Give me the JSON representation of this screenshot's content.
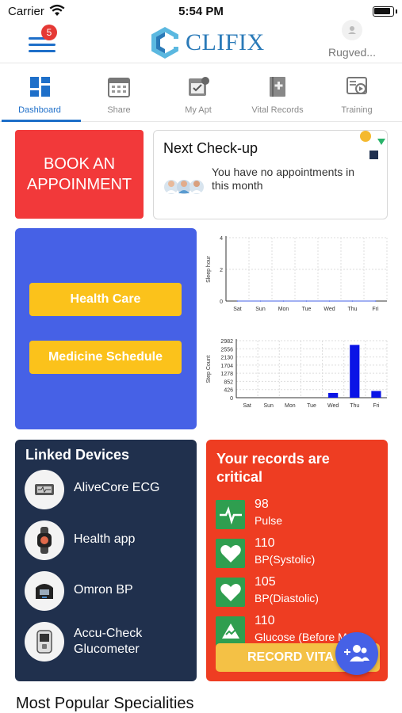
{
  "status_bar": {
    "carrier": "Carrier",
    "time": "5:54 PM"
  },
  "header": {
    "menu_badge": "5",
    "logo_text": "CLIFIX",
    "profile_name": "Rugved..."
  },
  "tabs": [
    {
      "label": "Dashboard",
      "icon": "dashboard-icon",
      "active": true
    },
    {
      "label": "Share",
      "icon": "calendar-icon"
    },
    {
      "label": "My Apt",
      "icon": "appointment-icon"
    },
    {
      "label": "Vital Records",
      "icon": "medical-book-icon"
    },
    {
      "label": "Training",
      "icon": "video-icon"
    }
  ],
  "book_card": {
    "label": "BOOK AN APPOINMENT"
  },
  "next_checkup": {
    "title": "Next Check-up",
    "message": "You have no appointments in this month"
  },
  "quick_actions": {
    "health_care": "Health Care",
    "medicine_schedule": "Medicine Schedule"
  },
  "chart_data": [
    {
      "type": "line",
      "categories": [
        "Sat",
        "Sun",
        "Mon",
        "Tue",
        "Wed",
        "Thu",
        "Fri"
      ],
      "values": [
        0,
        0,
        0,
        0,
        0,
        0,
        0
      ],
      "ylabel": "Sleep hour",
      "yticks": [
        "0",
        "2",
        "4"
      ],
      "ylim": [
        0,
        4
      ],
      "grid": true
    },
    {
      "type": "bar",
      "categories": [
        "Sat",
        "Sun",
        "Mon",
        "Tue",
        "Wed",
        "Thu",
        "Fri"
      ],
      "values": [
        0,
        0,
        0,
        0,
        250,
        2760,
        350
      ],
      "ylabel": "Step Count",
      "yticks": [
        "0",
        "426",
        "852",
        "1278",
        "1704",
        "2130",
        "2556",
        "2982"
      ],
      "ylim": [
        0,
        2982
      ],
      "bar_color": "#0a14e6",
      "grid": true
    }
  ],
  "linked_devices": {
    "title": "Linked Devices",
    "items": [
      {
        "name": "AliveCore ECG",
        "icon": "ecg-device-icon"
      },
      {
        "name": "Health app",
        "icon": "smartwatch-icon"
      },
      {
        "name": "Omron BP",
        "icon": "bp-monitor-icon"
      },
      {
        "name": "Accu-Check Glucometer",
        "icon": "glucometer-icon"
      }
    ]
  },
  "records": {
    "title": "Your records are critical",
    "items": [
      {
        "value": "98",
        "label": "Pulse",
        "icon": "pulse-icon"
      },
      {
        "value": "110",
        "label": "BP(Systolic)",
        "icon": "heart-icon"
      },
      {
        "value": "105",
        "label": "BP(Diastolic)",
        "icon": "heart-icon"
      },
      {
        "value": "110",
        "label": "Glucose (Before Meal)",
        "icon": "glucose-icon"
      }
    ],
    "button": "RECORD VITA"
  },
  "fab": {
    "icon": "add-group-icon"
  },
  "section": {
    "title": "Most Popular Specialities"
  },
  "colors": {
    "primary_blue": "#1e6fc9",
    "book_red": "#f2393a",
    "panel_blue": "#4661e6",
    "yellow": "#fbc21b",
    "devices_navy": "#20304d",
    "records_red": "#ee3d22",
    "record_green": "#2f9e4f"
  }
}
